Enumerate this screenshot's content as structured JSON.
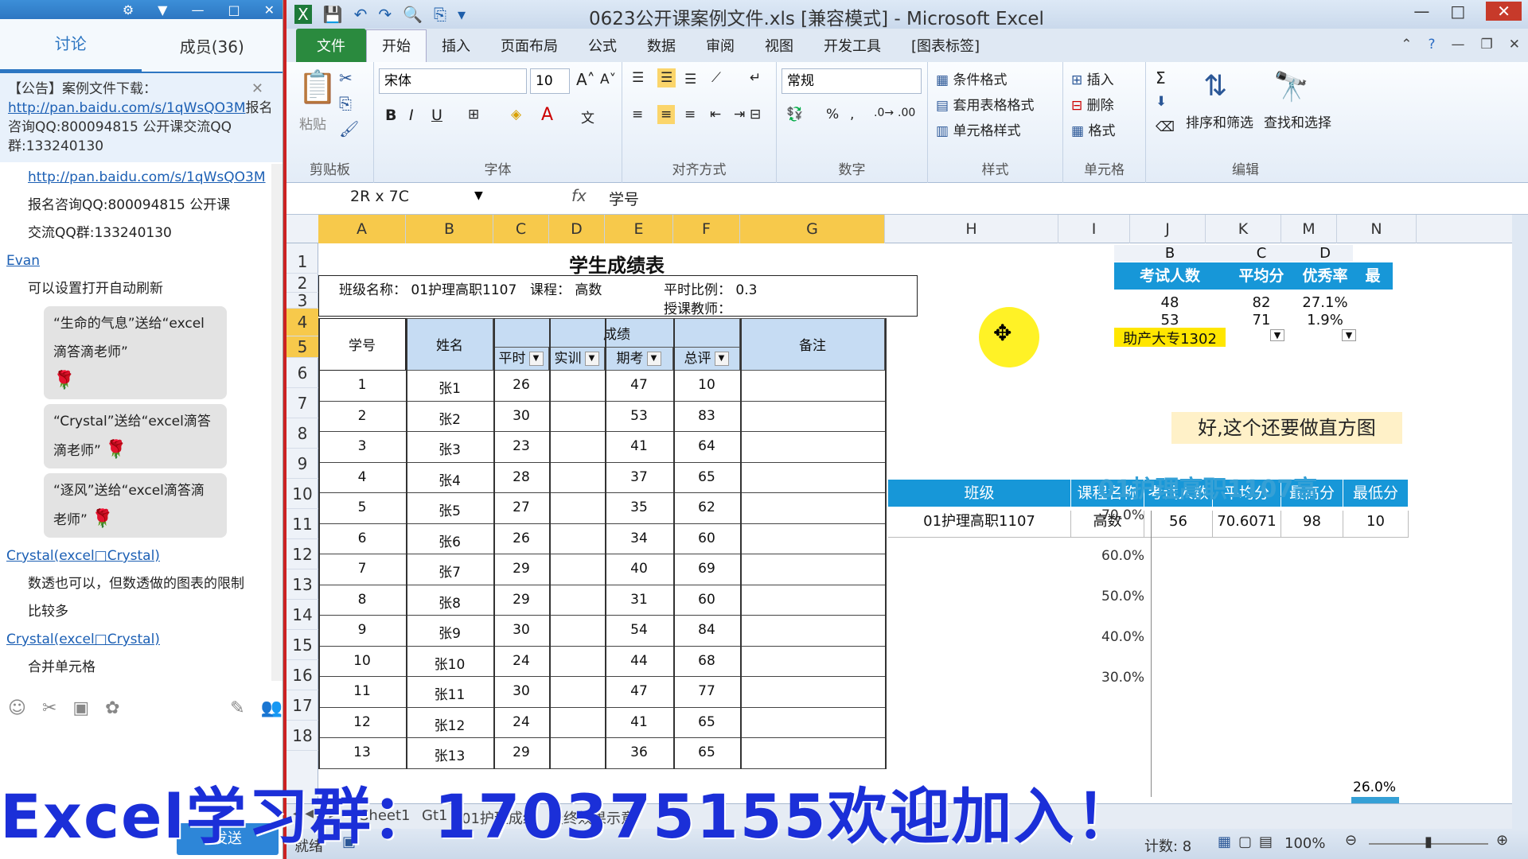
{
  "chat": {
    "tabs": [
      "讨论",
      "成员(36)"
    ],
    "notice": {
      "prefix": "【公告】案例文件下载：",
      "link": "http://pan.baidu.com/s/1qWsQO3M",
      "suffix": "报名咨询QQ:800094815  公开课交流QQ群:133240130"
    },
    "messages": [
      {
        "type": "link",
        "text": "http://pan.baidu.com/s/1qWsQO3M"
      },
      {
        "type": "text",
        "text": "报名咨询QQ:800094815  公开课"
      },
      {
        "type": "text",
        "text": "交流QQ群:133240130"
      },
      {
        "type": "name",
        "text": "Evan"
      },
      {
        "type": "text",
        "text": "可以设置打开自动刷新"
      },
      {
        "type": "bubble",
        "text": "“生命的气息”送给“excel滴答滴老师”"
      },
      {
        "type": "bubble",
        "text": "“Crystal”送给“excel滴答滴老师”"
      },
      {
        "type": "bubble",
        "text": "“逐风”送给“excel滴答滴老师”"
      },
      {
        "type": "name",
        "text": "Crystal(excel□Crystal)"
      },
      {
        "type": "text",
        "text": "数透也可以，但数透做的图表的限制"
      },
      {
        "type": "text",
        "text": "比较多"
      },
      {
        "type": "name",
        "text": "Crystal(excel□Crystal)"
      },
      {
        "type": "text",
        "text": "合并单元格"
      }
    ],
    "send": "发送"
  },
  "excel": {
    "title": "0623公开课案例文件.xls  [兼容模式] - Microsoft Excel",
    "tabs": [
      "文件",
      "开始",
      "插入",
      "页面布局",
      "公式",
      "数据",
      "审阅",
      "视图",
      "开发工具",
      "[图表标签]"
    ],
    "ribbon": {
      "clipboard": "剪贴板",
      "paste": "粘贴",
      "font_group": "字体",
      "font": "宋体",
      "size": "10",
      "align_group": "对齐方式",
      "number_group": "数字",
      "number_format": "常规",
      "styles_group": "样式",
      "cond_format": "条件格式",
      "table_format": "套用表格格式",
      "cell_style": "单元格样式",
      "cells_group": "单元格",
      "insert": "插入",
      "delete": "删除",
      "format": "格式",
      "edit_group": "编辑",
      "sort": "排序和筛选",
      "find": "查找和选择"
    },
    "namebox": "2R x 7C",
    "formula": "学号",
    "columns": [
      "A",
      "B",
      "C",
      "D",
      "E",
      "F",
      "G",
      "H",
      "I",
      "J",
      "K",
      "M",
      "N"
    ],
    "rows": [
      "1",
      "2",
      "3",
      "4",
      "5",
      "6",
      "7",
      "8",
      "9",
      "10",
      "11",
      "12",
      "13",
      "14",
      "15",
      "16",
      "17",
      "18"
    ],
    "sheet": {
      "title": "学生成绩表",
      "class_label": "班级名称： 01护理高职1107",
      "course_label": "课程： 高数",
      "ratio_label": "平时比例： 0.3",
      "teacher_label": "授课教师：",
      "h_id": "学号",
      "h_name": "姓名",
      "h_score": "成绩",
      "h_note": "备注",
      "h_sub": [
        "平时",
        "实训",
        "期考",
        "总评"
      ],
      "students": [
        [
          "1",
          "张1",
          "26",
          "47",
          "10"
        ],
        [
          "2",
          "张2",
          "30",
          "53",
          "83"
        ],
        [
          "3",
          "张3",
          "23",
          "41",
          "64"
        ],
        [
          "4",
          "张4",
          "28",
          "37",
          "65"
        ],
        [
          "5",
          "张5",
          "27",
          "35",
          "62"
        ],
        [
          "6",
          "张6",
          "26",
          "34",
          "60"
        ],
        [
          "7",
          "张7",
          "29",
          "40",
          "69"
        ],
        [
          "8",
          "张8",
          "29",
          "31",
          "60"
        ],
        [
          "9",
          "张9",
          "30",
          "54",
          "84"
        ],
        [
          "10",
          "张10",
          "24",
          "44",
          "68"
        ],
        [
          "11",
          "张11",
          "30",
          "47",
          "77"
        ],
        [
          "12",
          "张12",
          "24",
          "41",
          "65"
        ],
        [
          "13",
          "张13",
          "29",
          "36",
          "65"
        ]
      ]
    },
    "side_table": {
      "cols": [
        "B",
        "C",
        "D"
      ],
      "headers": [
        "考试人数",
        "平均分",
        "优秀率",
        "最"
      ],
      "rows": [
        [
          "48",
          "82",
          "27.1%"
        ],
        [
          "53",
          "71",
          "1.9%"
        ]
      ],
      "dropdown": "助产大专1302"
    },
    "comment": "好,这个还要做直方图",
    "summary": {
      "headers": [
        "班级",
        "课程名称",
        "考试人数",
        "平均分",
        "最高分",
        "最低分"
      ],
      "row": [
        "01护理高职1107",
        "高数",
        "56",
        "70.6071",
        "98",
        "10"
      ]
    },
    "chart": {
      "title": "01护理高职1107高",
      "yticks": [
        "70.0%",
        "60.0%",
        "50.0%",
        "40.0%",
        "30.0%"
      ],
      "label": "26.0%"
    },
    "sheets": [
      "Sheet1",
      "Gt1",
      "01护理成绩",
      "最终效果示意"
    ],
    "status": {
      "ready": "就绪",
      "count": "计数: 8",
      "zoom": "100%"
    }
  },
  "overlay": "Excel学习群：170375155欢迎加入！",
  "colors": {
    "accent": "#1797d8",
    "selection": "#f7c94b",
    "overlay": "#1b2fd8"
  }
}
